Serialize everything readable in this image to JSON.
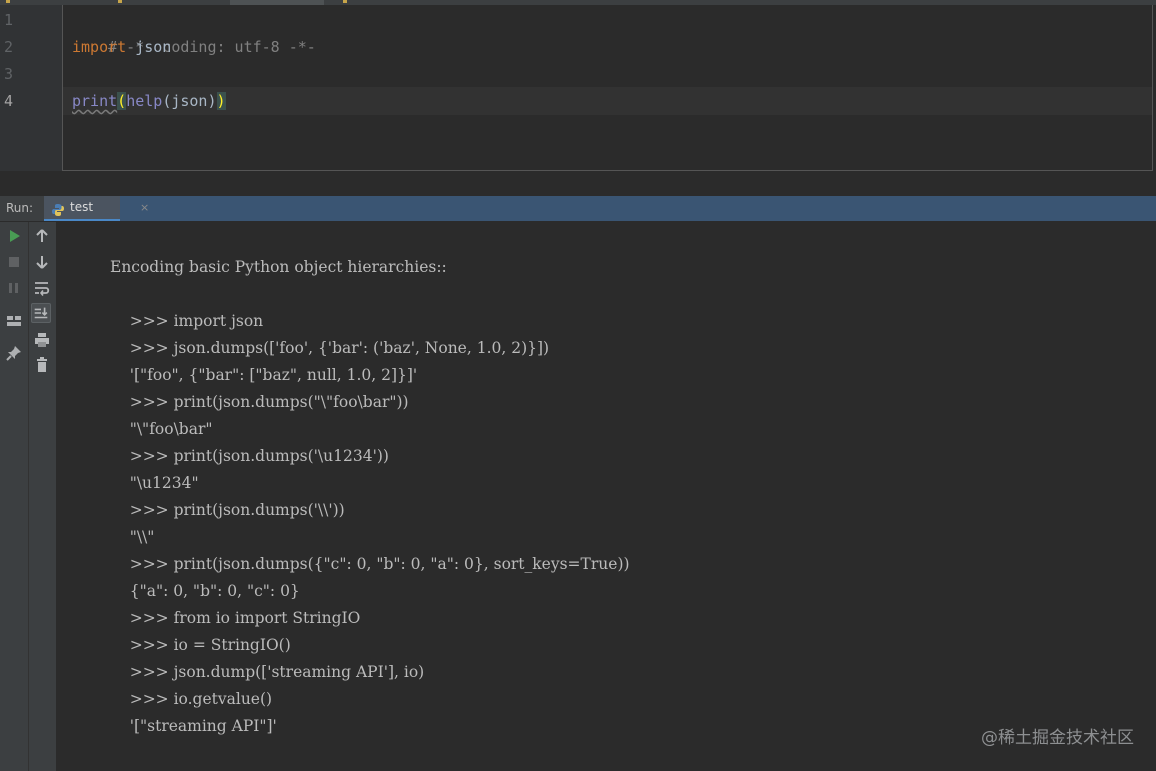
{
  "editor": {
    "line_numbers": [
      "1",
      "2",
      "3",
      "4"
    ],
    "lines": {
      "l1_comment": "# -*- coding: utf-8 -*-",
      "l2_keyword": "import",
      "l2_rest": " json",
      "l4_print": "print",
      "l4_open": "(",
      "l4_help": "help",
      "l4_args": "(json)",
      "l4_close": ")"
    }
  },
  "run_panel": {
    "label": "Run:",
    "tab": {
      "label": "test",
      "close": "×"
    }
  },
  "toolbar": {
    "left": [
      "run-icon",
      "stop-icon",
      "pause-icon",
      "layout-icon",
      "pin-icon"
    ],
    "right": [
      "up-arrow-icon",
      "down-arrow-icon",
      "soft-wrap-icon",
      "scroll-to-end-icon",
      "print-icon",
      "trash-icon"
    ]
  },
  "console": {
    "lines": [
      "Encoding basic Python object hierarchies::",
      "    >>> import json",
      "    >>> json.dumps(['foo', {'bar': ('baz', None, 1.0, 2)}])",
      "    '[\"foo\", {\"bar\": [\"baz\", null, 1.0, 2]}]'",
      "    >>> print(json.dumps(\"\\\"foo\\bar\"))",
      "    \"\\\"foo\\bar\"",
      "    >>> print(json.dumps('\\u1234'))",
      "    \"\\u1234\"",
      "    >>> print(json.dumps('\\\\'))",
      "    \"\\\\\"",
      "    >>> print(json.dumps({\"c\": 0, \"b\": 0, \"a\": 0}, sort_keys=True))",
      "    {\"a\": 0, \"b\": 0, \"c\": 0}",
      "    >>> from io import StringIO",
      "    >>> io = StringIO()",
      "    >>> json.dump(['streaming API'], io)",
      "    >>> io.getvalue()",
      "    '[\"streaming API\"]'"
    ]
  },
  "watermark": "@稀土掘金技术社区",
  "colors": {
    "editor_bg": "#2b2b2b",
    "gutter_bg": "#313335",
    "keyword": "#cc7832",
    "builtin": "#8888c6",
    "comment": "#808080",
    "console_text": "#bbbbbb",
    "run_green": "#499c54",
    "tab_accent": "#4a88c7"
  }
}
